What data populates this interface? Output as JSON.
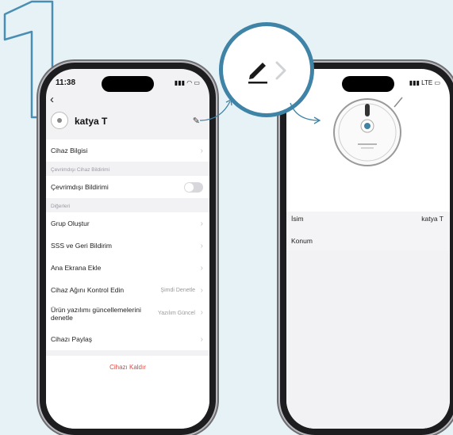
{
  "step_number": "1",
  "colors": {
    "accent": "#3f83a6",
    "destructive": "#e0463c",
    "background": "#e6f2f6"
  },
  "left_phone": {
    "time": "11:38",
    "device_name": "katya T",
    "rows": {
      "device_info": "Cihaz Bilgisi",
      "offline_section": "Çevrimdışı Cihaz Bildirimi",
      "offline_toggle": "Çevrimdışı Bildirimi",
      "others_section": "Diğerleri",
      "create_group": "Grup Oluştur",
      "faq": "SSS ve Geri Bildirim",
      "add_home": "Ana Ekrana Ekle",
      "network_check": "Cihaz Ağını Kontrol Edin",
      "network_check_value": "Şimdi Denetle",
      "firmware_line1": "Ürün yazılımı güncellemelerini",
      "firmware_line2": "denetle",
      "firmware_value": "Yazılım Güncel",
      "share": "Cihazı Paylaş",
      "remove": "Cihazı Kaldır"
    },
    "offline_toggle_on": false
  },
  "right_phone": {
    "status_icons": "LTE",
    "name_label": "İsim",
    "name_value": "katya T",
    "location_label": "Konum"
  },
  "zoom": {
    "icons": [
      "pencil-icon",
      "chevron-right-icon"
    ]
  }
}
